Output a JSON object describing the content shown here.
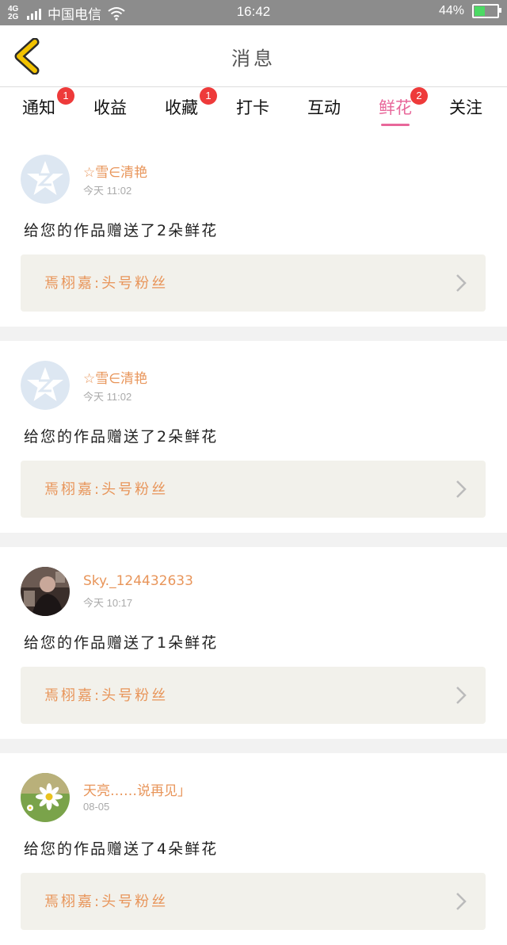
{
  "status_bar": {
    "network": "4G 2G",
    "carrier": "中国电信",
    "time": "16:42",
    "battery": "44%",
    "battery_level": 0.44
  },
  "header": {
    "title": "消息",
    "back_icon": "chevron-left-icon",
    "accent_color": "#f2c200"
  },
  "tabs": [
    {
      "label": "通知",
      "badge": "1"
    },
    {
      "label": "收益",
      "badge": ""
    },
    {
      "label": "收藏",
      "badge": "1"
    },
    {
      "label": "打卡",
      "badge": ""
    },
    {
      "label": "互动",
      "badge": ""
    },
    {
      "label": "鲜花",
      "badge": "2",
      "active": true
    },
    {
      "label": "关注",
      "badge": ""
    }
  ],
  "messages": [
    {
      "user": "☆雪∈清艳",
      "time": "今天 11:02",
      "text": "给您的作品赠送了2朵鲜花",
      "work": "焉栩嘉:头号粉丝",
      "avatar": "default-avatar-icon"
    },
    {
      "user": "☆雪∈清艳",
      "time": "今天 11:02",
      "text": "给您的作品赠送了2朵鲜花",
      "work": "焉栩嘉:头号粉丝",
      "avatar": "default-avatar-icon"
    },
    {
      "user": "Sky._124432633",
      "time": "今天 10:17",
      "text": "给您的作品赠送了1朵鲜花",
      "work": "焉栩嘉:头号粉丝",
      "avatar": "photo-avatar"
    },
    {
      "user": "天亮……说再见」",
      "time": "08-05",
      "text": "给您的作品赠送了4朵鲜花",
      "work": "焉栩嘉:头号粉丝",
      "avatar": "daisy-avatar"
    }
  ]
}
